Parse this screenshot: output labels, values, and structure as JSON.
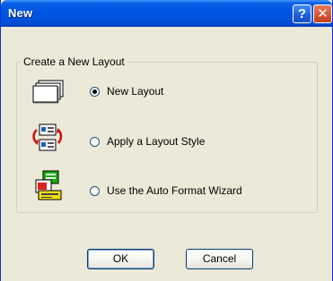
{
  "window": {
    "title": "New",
    "help_icon": "question-mark",
    "close_icon": "x"
  },
  "group": {
    "legend": "Create a New Layout",
    "options": [
      {
        "label": "New Layout",
        "icon": "blank-page-icon",
        "checked": true
      },
      {
        "label": "Apply a Layout Style",
        "icon": "apply-style-icon",
        "checked": false
      },
      {
        "label": "Use the Auto Format Wizard",
        "icon": "wizard-icon",
        "checked": false
      }
    ]
  },
  "buttons": {
    "ok": "OK",
    "cancel": "Cancel"
  },
  "colors": {
    "titlebar": "#0054e3",
    "dialog_bg": "#ece9d8",
    "close": "#d65632"
  }
}
